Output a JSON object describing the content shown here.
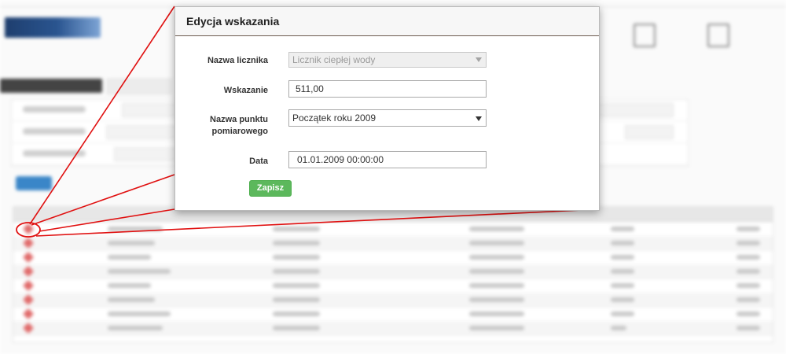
{
  "modal": {
    "title": "Edycja wskazania",
    "fields": {
      "meter_name": {
        "label": "Nazwa licznika",
        "value": "Licznik ciepłej wody"
      },
      "reading": {
        "label": "Wskazanie",
        "value": "511,00"
      },
      "measurement_point": {
        "label_line1": "Nazwa punktu",
        "label_line2": "pomiarowego",
        "value": "Początek roku 2009"
      },
      "date": {
        "label": "Data",
        "value": "01.01.2009 00:00:00"
      }
    },
    "save_label": "Zapisz"
  },
  "colors": {
    "annotation_red": "#e01010",
    "save_green": "#5cb85c",
    "header_rule": "#6d5b4f"
  },
  "icons": {
    "background_row_action": "pencil-edit-icon",
    "select_caret": "caret-down-icon"
  }
}
